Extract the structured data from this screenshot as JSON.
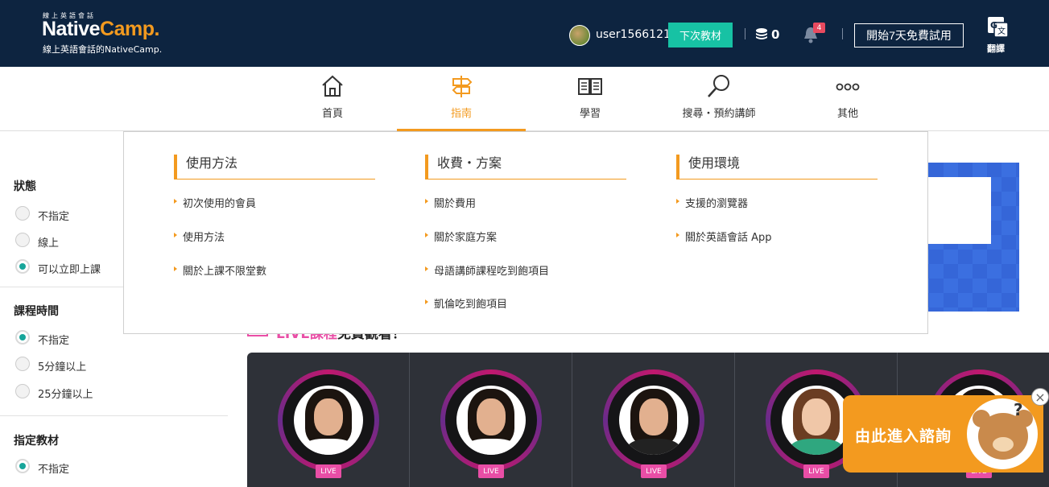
{
  "header": {
    "logo_small": "線上英語會話",
    "logo_brand_a": "Native",
    "logo_brand_b": "Camp.",
    "logo_tagline": "線上英語會話的NativeCamp.",
    "username": "user1566121",
    "next_material_label": "下次教材",
    "coin_count": "0",
    "notification_count": "4",
    "trial_label": "開始7天免費試用",
    "translate_label": "翻譯"
  },
  "nav": {
    "items": [
      {
        "label": "首頁",
        "icon": "home-icon"
      },
      {
        "label": "指南",
        "icon": "signpost-icon",
        "active": true
      },
      {
        "label": "學習",
        "icon": "book-icon"
      },
      {
        "label": "搜尋・預約講師",
        "icon": "search-icon"
      },
      {
        "label": "其他",
        "icon": "more-icon"
      }
    ]
  },
  "mega_menu": {
    "columns": [
      {
        "title": "使用方法",
        "links": [
          "初次使用的會員",
          "使用方法",
          "關於上課不限堂數"
        ]
      },
      {
        "title": "收費・方案",
        "links": [
          "關於費用",
          "關於家庭方案",
          "母語講師課程吃到飽項目",
          "凱倫吃到飽項目"
        ]
      },
      {
        "title": "使用環境",
        "links": [
          "支援的瀏覽器",
          "關於英語會話 App"
        ]
      }
    ]
  },
  "filters": {
    "groups": [
      {
        "title": "狀態",
        "options": [
          "不指定",
          "線上",
          "可以立即上課"
        ],
        "selected": 2
      },
      {
        "title": "課程時間",
        "options": [
          "不指定",
          "5分鐘以上",
          "25分鐘以上"
        ],
        "selected": 0
      },
      {
        "title": "指定教材",
        "options": [
          "不指定"
        ],
        "selected": 0
      }
    ]
  },
  "live": {
    "heading_pink": "LIVE課程",
    "heading_rest": "免費觀看！",
    "badge": "LIVE",
    "teacher_count": 5
  },
  "chat": {
    "label": "由此進入諮詢",
    "close": "×"
  },
  "colors": {
    "header_bg": "#0d2440",
    "accent_orange": "#f39a1f",
    "teal": "#17c2a4",
    "live_pink": "#e94ea6"
  }
}
